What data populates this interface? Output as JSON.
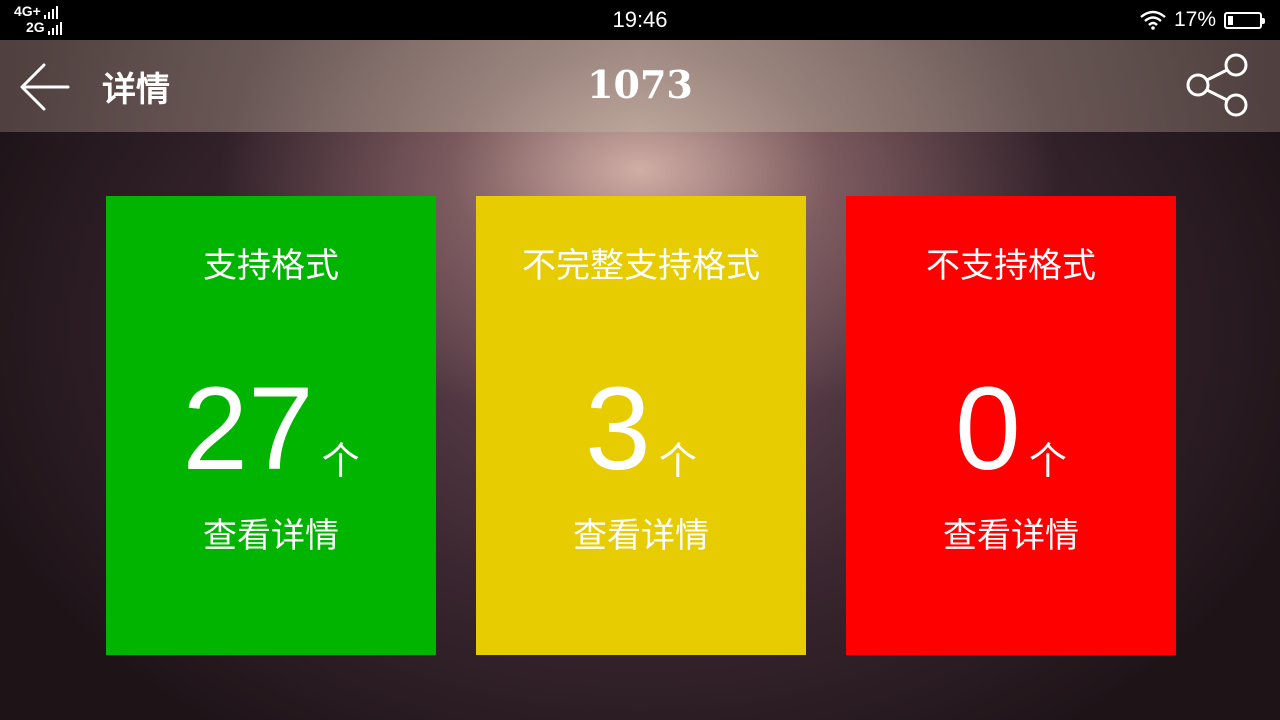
{
  "status_bar": {
    "network_top": "4G+",
    "network_bottom": "2G",
    "time": "19:46",
    "battery_percent": "17%",
    "battery_level": 0.17
  },
  "header": {
    "back_icon": "arrow-left-icon",
    "label": "详情",
    "title": "1073",
    "share_icon": "share-icon"
  },
  "cards": [
    {
      "title": "支持格式",
      "count": "27",
      "unit": "个",
      "link": "查看详情",
      "color": "#00b400"
    },
    {
      "title": "不完整支持格式",
      "count": "3",
      "unit": "个",
      "link": "查看详情",
      "color": "#e6cc00"
    },
    {
      "title": "不支持格式",
      "count": "0",
      "unit": "个",
      "link": "查看详情",
      "color": "#ff0000"
    }
  ]
}
